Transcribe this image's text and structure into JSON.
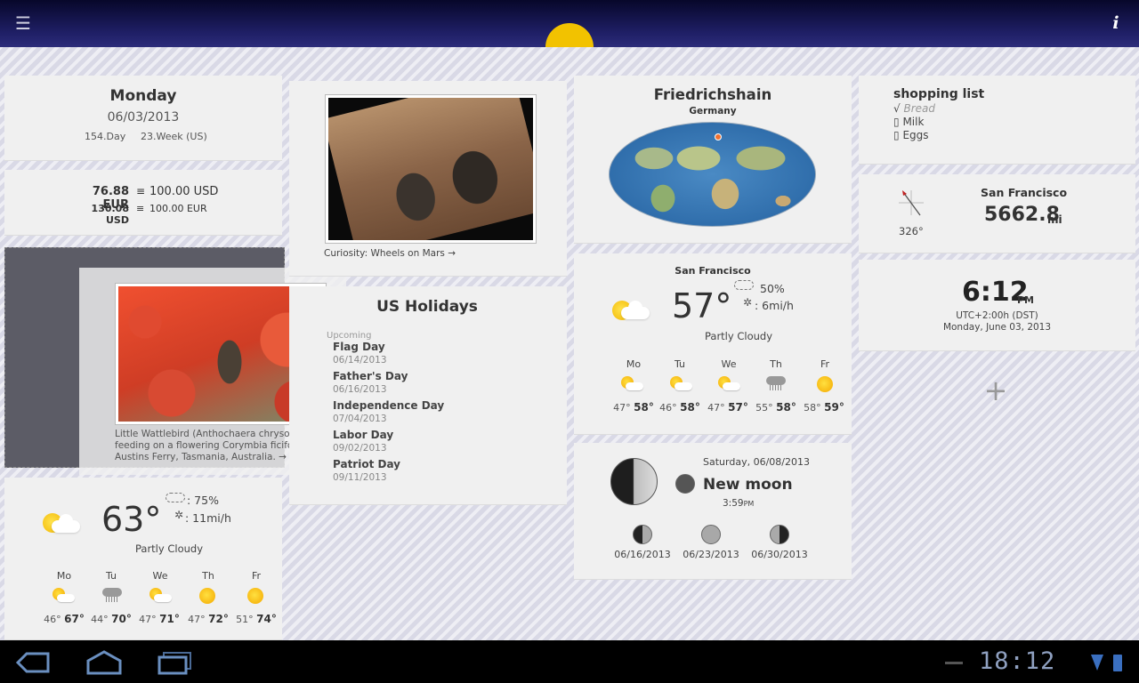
{
  "topbar": {
    "menu_icon": "menu-icon",
    "info_label": "i"
  },
  "date_widget": {
    "day": "Monday",
    "date": "06/03/2013",
    "day_of_year": "154.Day",
    "week": "23.Week (US)"
  },
  "currency": {
    "row1_amount": "76.88 EUR",
    "row1_eq": "≡",
    "row1_target": "100.00 USD",
    "row2_amount": "130.08 USD",
    "row2_eq": "≡",
    "row2_target": "100.00 EUR"
  },
  "bird_photo": {
    "caption": "Little Wattlebird (Anthochaera chrysoptera) feeding on a flowering Corymbia ficifolia, Austins Ferry, Tasmania, Australia. →"
  },
  "weather_local": {
    "temp": "63°",
    "precip": ": 75%",
    "wind": ": 11mi/h",
    "condition": "Partly Cloudy",
    "forecast": [
      {
        "day": "Mo",
        "low": "46°",
        "high": "67°",
        "icon": "partly-cloudy"
      },
      {
        "day": "Tu",
        "low": "44°",
        "high": "70°",
        "icon": "rain"
      },
      {
        "day": "We",
        "low": "47°",
        "high": "71°",
        "icon": "partly-cloudy"
      },
      {
        "day": "Th",
        "low": "47°",
        "high": "72°",
        "icon": "sunny"
      },
      {
        "day": "Fr",
        "low": "51°",
        "high": "74°",
        "icon": "sunny"
      }
    ]
  },
  "mars_photo": {
    "caption": "Curiosity: Wheels on Mars →"
  },
  "holidays": {
    "title": "US Holidays",
    "upcoming_label": "Upcoming",
    "items": [
      {
        "name": "Flag Day",
        "date": "06/14/2013"
      },
      {
        "name": "Father's Day",
        "date": "06/16/2013"
      },
      {
        "name": "Independence Day",
        "date": "07/04/2013"
      },
      {
        "name": "Labor Day",
        "date": "09/02/2013"
      },
      {
        "name": "Patriot Day",
        "date": "09/11/2013"
      }
    ]
  },
  "map_widget": {
    "city": "Friedrichshain",
    "country": "Germany"
  },
  "weather_sf": {
    "city": "San Francisco",
    "temp": "57°",
    "precip": "50%",
    "wind": ": 6mi/h",
    "condition": "Partly Cloudy",
    "forecast": [
      {
        "day": "Mo",
        "low": "47°",
        "high": "58°",
        "icon": "partly-cloudy"
      },
      {
        "day": "Tu",
        "low": "46°",
        "high": "58°",
        "icon": "partly-cloudy"
      },
      {
        "day": "We",
        "low": "47°",
        "high": "57°",
        "icon": "partly-cloudy"
      },
      {
        "day": "Th",
        "low": "55°",
        "high": "58°",
        "icon": "rain"
      },
      {
        "day": "Fr",
        "low": "58°",
        "high": "59°",
        "icon": "sunny"
      }
    ]
  },
  "moon_widget": {
    "date": "Saturday, 06/08/2013",
    "phase": "New moon",
    "time": "3:59",
    "time_suffix": "PM",
    "upcoming": [
      {
        "date": "06/16/2013"
      },
      {
        "date": "06/23/2013"
      },
      {
        "date": "06/30/2013"
      }
    ]
  },
  "shopping_list": {
    "title": "shopping list",
    "items": [
      {
        "mark": "√",
        "text": "Bread",
        "done": true
      },
      {
        "mark": "▯",
        "text": "Milk",
        "done": false
      },
      {
        "mark": "▯",
        "text": "Eggs",
        "done": false
      }
    ]
  },
  "distance_widget": {
    "city": "San Francisco",
    "distance": "5662.8",
    "unit": "mi",
    "bearing": "326°"
  },
  "clock_widget": {
    "time": "6:12",
    "ampm": "PM",
    "utc": "UTC+2:00h (DST)",
    "date": "Monday, June 03, 2013"
  },
  "add_widget": {
    "label": "+"
  },
  "statusbar": {
    "time": "18:12"
  },
  "colors": {
    "accent": "#f2c200",
    "nav_blue": "#6a8fc0",
    "topbar": "#1f1f66"
  }
}
